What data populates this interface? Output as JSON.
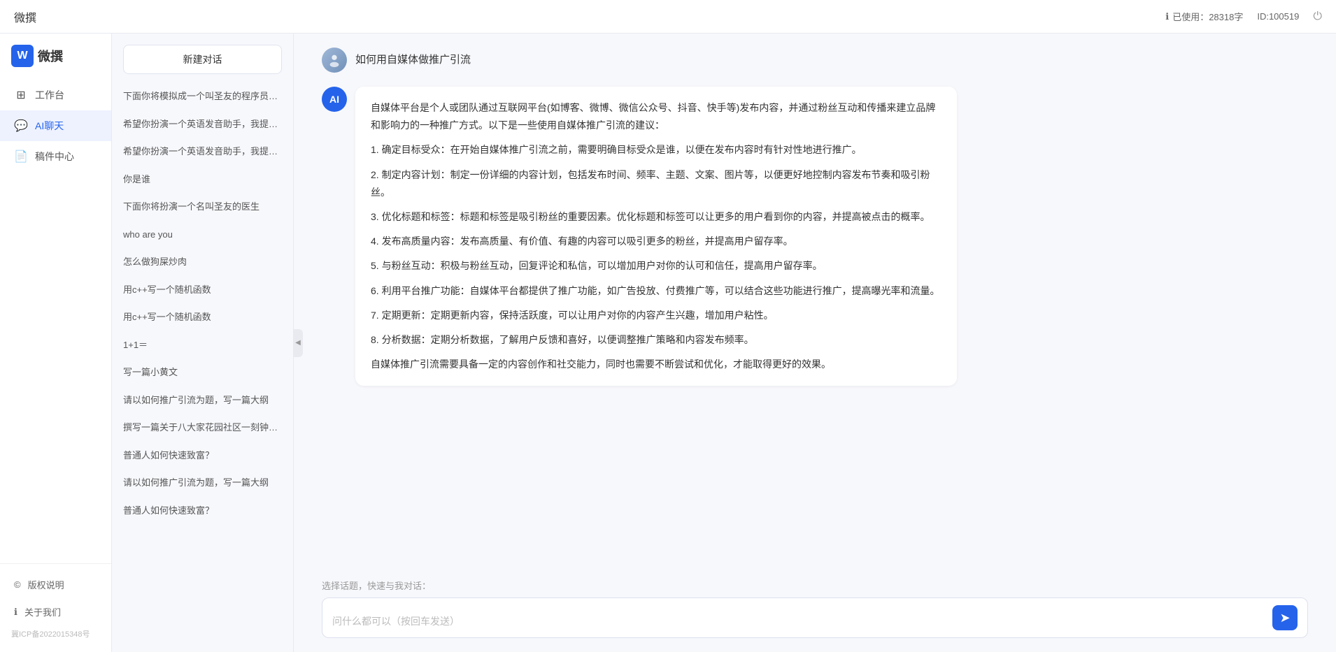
{
  "topbar": {
    "title": "微撰",
    "usage_label": "已使用：28318字",
    "id_label": "ID:100519",
    "usage_icon": "ℹ",
    "power_icon": "⏻"
  },
  "sidebar": {
    "logo_letter": "W",
    "logo_text": "微撰",
    "nav_items": [
      {
        "id": "workspace",
        "label": "工作台",
        "icon": "⊞"
      },
      {
        "id": "ai-chat",
        "label": "AI聊天",
        "icon": "💬"
      },
      {
        "id": "drafts",
        "label": "稿件中心",
        "icon": "📄"
      }
    ],
    "footer_items": [
      {
        "id": "copyright",
        "label": "版权说明",
        "icon": "©"
      },
      {
        "id": "about",
        "label": "关于我们",
        "icon": "ℹ"
      }
    ],
    "icp": "冀ICP备2022015348号"
  },
  "chat_list": {
    "new_chat_label": "新建对话",
    "items": [
      {
        "id": 1,
        "text": "下面你将模拟成一个叫圣友的程序员、我说..."
      },
      {
        "id": 2,
        "text": "希望你扮演一个英语发音助手，我提供给你..."
      },
      {
        "id": 3,
        "text": "希望你扮演一个英语发音助手，我提供给你..."
      },
      {
        "id": 4,
        "text": "你是谁"
      },
      {
        "id": 5,
        "text": "下面你将扮演一个名叫圣友的医生"
      },
      {
        "id": 6,
        "text": "who are you"
      },
      {
        "id": 7,
        "text": "怎么做狗屎炒肉"
      },
      {
        "id": 8,
        "text": "用c++写一个随机函数"
      },
      {
        "id": 9,
        "text": "用c++写一个随机函数"
      },
      {
        "id": 10,
        "text": "1+1＝"
      },
      {
        "id": 11,
        "text": "写一篇小黄文"
      },
      {
        "id": 12,
        "text": "请以如何推广引流为题，写一篇大纲"
      },
      {
        "id": 13,
        "text": "撰写一篇关于八大家花园社区一刻钟便民生..."
      },
      {
        "id": 14,
        "text": "普通人如何快速致富？"
      },
      {
        "id": 15,
        "text": "请以如何推广引流为题，写一篇大纲"
      },
      {
        "id": 16,
        "text": "普通人如何快速致富？"
      }
    ]
  },
  "chat": {
    "user_question": "如何用自媒体做推广引流",
    "ai_response": {
      "paragraphs": [
        "自媒体平台是个人或团队通过互联网平台(如博客、微博、微信公众号、抖音、快手等)发布内容，并通过粉丝互动和传播来建立品牌和影响力的一种推广方式。以下是一些使用自媒体推广引流的建议：",
        "1. 确定目标受众：在开始自媒体推广引流之前，需要明确目标受众是谁，以便在发布内容时有针对性地进行推广。",
        "2. 制定内容计划：制定一份详细的内容计划，包括发布时间、频率、主题、文案、图片等，以便更好地控制内容发布节奏和吸引粉丝。",
        "3. 优化标题和标签：标题和标签是吸引粉丝的重要因素。优化标题和标签可以让更多的用户看到你的内容，并提高被点击的概率。",
        "4. 发布高质量内容：发布高质量、有价值、有趣的内容可以吸引更多的粉丝，并提高用户留存率。",
        "5. 与粉丝互动：积极与粉丝互动，回复评论和私信，可以增加用户对你的认可和信任，提高用户留存率。",
        "6. 利用平台推广功能：自媒体平台都提供了推广功能，如广告投放、付费推广等，可以结合这些功能进行推广，提高曝光率和流量。",
        "7. 定期更新：定期更新内容，保持活跃度，可以让用户对你的内容产生兴趣，增加用户粘性。",
        "8. 分析数据：定期分析数据，了解用户反馈和喜好，以便调整推广策略和内容发布频率。",
        "自媒体推广引流需要具备一定的内容创作和社交能力，同时也需要不断尝试和优化，才能取得更好的效果。"
      ]
    },
    "input_placeholder": "问什么都可以（按回车发送）",
    "quick_topic_label": "选择话题，快速与我对话：",
    "send_icon": "➤"
  }
}
